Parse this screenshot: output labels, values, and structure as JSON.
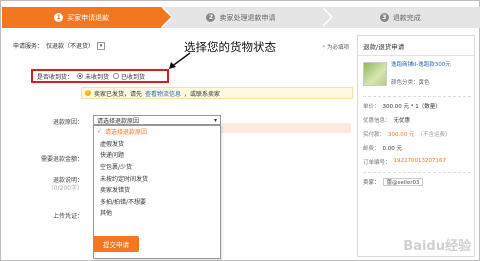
{
  "steps": [
    {
      "num": "1",
      "label": "买家申请退款"
    },
    {
      "num": "2",
      "label": "卖家处理退款申请"
    },
    {
      "num": "3",
      "label": "退款完成"
    }
  ],
  "service": {
    "label": "申请服务：",
    "value": "仅退款（不退货）",
    "rules_link": "为必填项"
  },
  "goods_status": {
    "label": "是否收到货：",
    "options": [
      "未收到货",
      "已收到货"
    ],
    "selected": 0
  },
  "annotation": "选择您的货物状态",
  "notice": {
    "text": "卖家已发货，请先",
    "link": "查看物流信息",
    "suffix": "，或联系卖家"
  },
  "reason": {
    "label": "退款原因：",
    "placeholder": "请选择退款原因",
    "options": [
      "请选择退款原因",
      "虚假发货",
      "快递问题",
      "空包裹/少货",
      "未按约定时间发货",
      "卖家发错货",
      "多拍/拍错/不想要",
      "其他"
    ],
    "selected": 0
  },
  "labels": {
    "amount": "需要退款金额：",
    "explain": "退款说明：",
    "explain_hint": "（0/200字）",
    "upload": "上传凭证："
  },
  "submit_label": "提交申请",
  "panel": {
    "title": "退款/退货申请",
    "product_name": "逸跑商铺II-逸跑款300元",
    "product_color": "颜色分类：黄色",
    "price_label": "单价：",
    "price_value": "300.00 元 * 1（数量）",
    "promo_label": "优惠信息：",
    "promo_value": "无优惠",
    "paid_label": "实付款：",
    "paid_value": "300.00 元",
    "paid_note": "（不含运费）",
    "shipping_label": "邮费：",
    "shipping_value": "0.00 元",
    "order_label": "订单编号：",
    "order_value": "192270013207167",
    "seller_label": "卖家：",
    "seller_value": "蕾@seller03"
  },
  "watermark": "Baidu经验",
  "colors": {
    "accent": "#f37621",
    "highlight_border": "#d32020",
    "link": "#2a6bb3"
  }
}
